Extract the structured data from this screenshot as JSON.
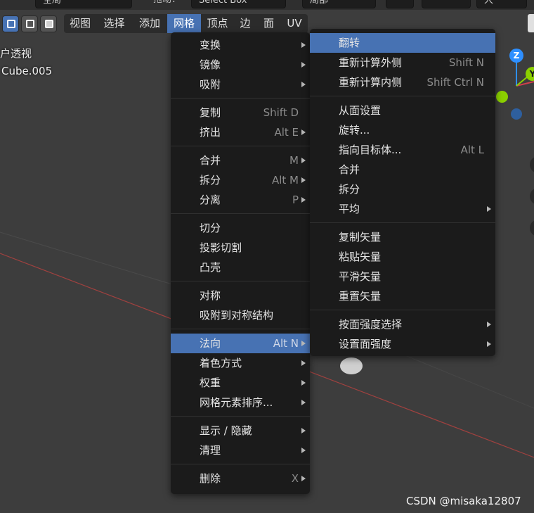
{
  "top_toolbar": {
    "transform_pivot": "全局",
    "drag_label": "拖动：",
    "select_mode": "Select Box",
    "snap_label": "局部",
    "proportional": "大"
  },
  "header": {
    "menus": [
      "视图",
      "选择",
      "添加",
      "网格",
      "顶点",
      "边",
      "面",
      "UV"
    ],
    "open_menu_index": 3
  },
  "viewport": {
    "view_label": "户透视",
    "object_name": "Cube.005"
  },
  "gizmo": {
    "z_label": "Z",
    "y_label": "Y"
  },
  "mesh_menu": {
    "items": [
      {
        "label": "变换",
        "shortcut": "",
        "submenu": true
      },
      {
        "label": "镜像",
        "shortcut": "",
        "submenu": true
      },
      {
        "label": "吸附",
        "shortcut": "",
        "submenu": true
      },
      {
        "separator": true
      },
      {
        "label": "复制",
        "shortcut": "Shift D",
        "submenu": false
      },
      {
        "label": "挤出",
        "shortcut": "Alt E",
        "submenu": true
      },
      {
        "separator": true
      },
      {
        "label": "合并",
        "shortcut": "M",
        "submenu": true
      },
      {
        "label": "拆分",
        "shortcut": "Alt M",
        "submenu": true
      },
      {
        "label": "分离",
        "shortcut": "P",
        "submenu": true
      },
      {
        "separator": true
      },
      {
        "label": "切分",
        "shortcut": "",
        "submenu": false
      },
      {
        "label": "投影切割",
        "shortcut": "",
        "submenu": false
      },
      {
        "label": "凸壳",
        "shortcut": "",
        "submenu": false
      },
      {
        "separator": true
      },
      {
        "label": "对称",
        "shortcut": "",
        "submenu": false
      },
      {
        "label": "吸附到对称结构",
        "shortcut": "",
        "submenu": false
      },
      {
        "separator": true
      },
      {
        "label": "法向",
        "shortcut": "Alt N",
        "submenu": true,
        "highlighted": true
      },
      {
        "label": "着色方式",
        "shortcut": "",
        "submenu": true
      },
      {
        "label": "权重",
        "shortcut": "",
        "submenu": true
      },
      {
        "label": "网格元素排序...",
        "shortcut": "",
        "submenu": true
      },
      {
        "separator": true
      },
      {
        "label": "显示 / 隐藏",
        "shortcut": "",
        "submenu": true
      },
      {
        "label": "清理",
        "shortcut": "",
        "submenu": true
      },
      {
        "separator": true
      },
      {
        "label": "删除",
        "shortcut": "X",
        "submenu": true
      }
    ]
  },
  "normals_menu": {
    "items": [
      {
        "label": "翻转",
        "shortcut": "",
        "submenu": false,
        "highlighted": true
      },
      {
        "label": "重新计算外侧",
        "shortcut": "Shift N",
        "submenu": false
      },
      {
        "label": "重新计算内侧",
        "shortcut": "Shift Ctrl N",
        "submenu": false
      },
      {
        "separator": true
      },
      {
        "label": "从面设置",
        "shortcut": "",
        "submenu": false
      },
      {
        "label": "旋转...",
        "shortcut": "",
        "submenu": false
      },
      {
        "label": "指向目标体...",
        "shortcut": "Alt L",
        "submenu": false
      },
      {
        "label": "合并",
        "shortcut": "",
        "submenu": false
      },
      {
        "label": "拆分",
        "shortcut": "",
        "submenu": false
      },
      {
        "label": "平均",
        "shortcut": "",
        "submenu": true
      },
      {
        "separator": true
      },
      {
        "label": "复制矢量",
        "shortcut": "",
        "submenu": false
      },
      {
        "label": "粘贴矢量",
        "shortcut": "",
        "submenu": false
      },
      {
        "label": "平滑矢量",
        "shortcut": "",
        "submenu": false
      },
      {
        "label": "重置矢量",
        "shortcut": "",
        "submenu": false
      },
      {
        "separator": true
      },
      {
        "label": "按面强度选择",
        "shortcut": "",
        "submenu": true
      },
      {
        "label": "设置面强度",
        "shortcut": "",
        "submenu": true
      }
    ]
  },
  "watermark": "CSDN @misaka12807",
  "colors": {
    "accent": "#4772b3",
    "menu_bg": "#1b1b1b",
    "viewport_bg": "#3d3d3d",
    "axis_x": "#d0404a",
    "axis_z": "#2e8fff",
    "axis_y": "#8bd000"
  }
}
